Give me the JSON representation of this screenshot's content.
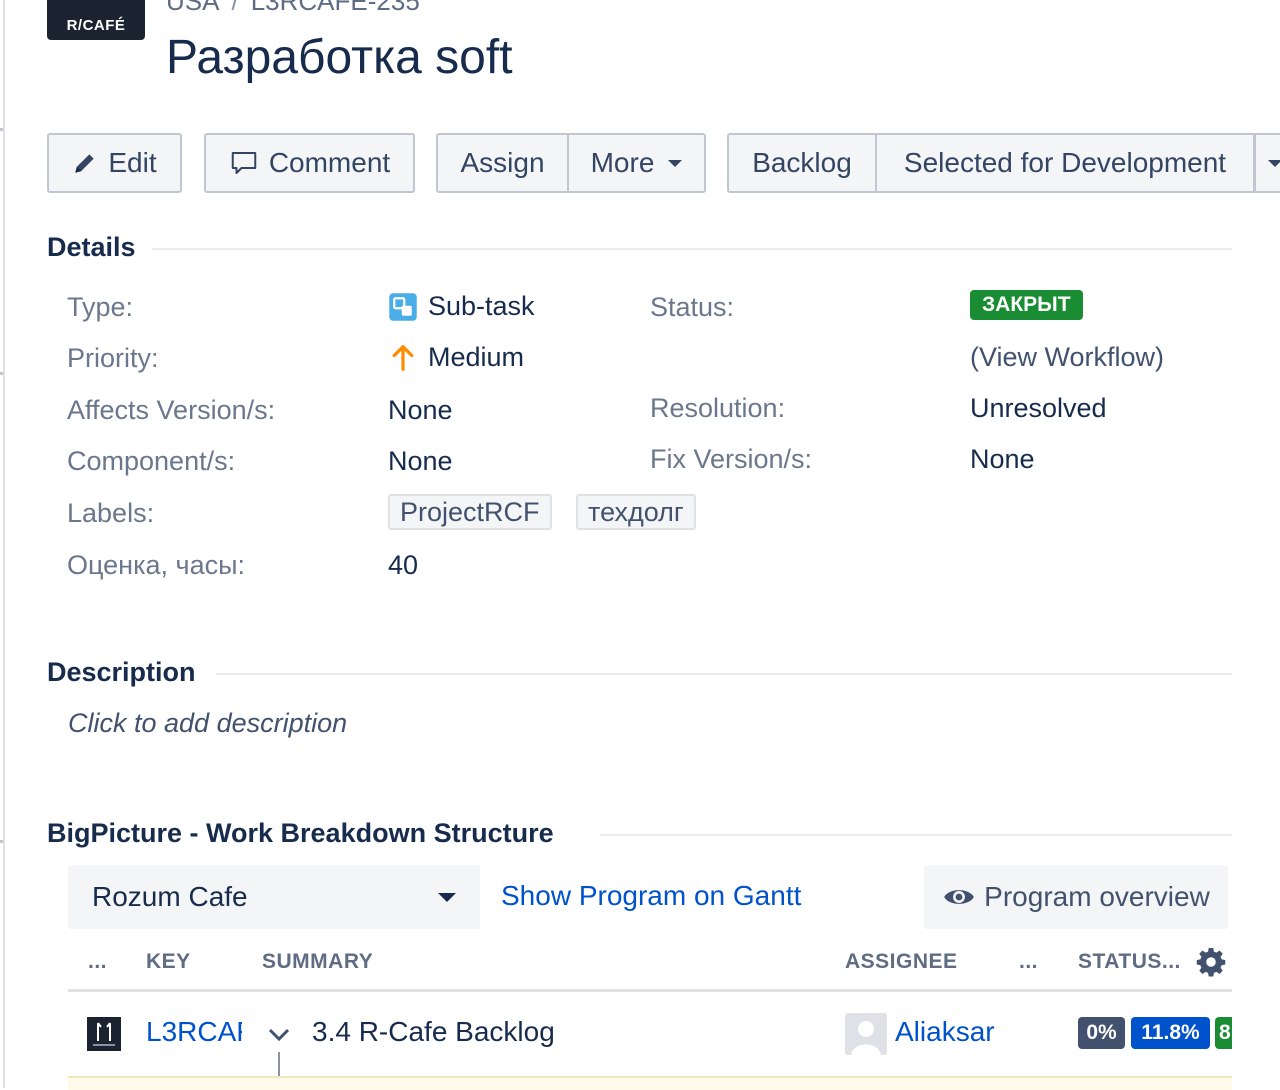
{
  "header": {
    "logo_text": "R/CAFÉ",
    "breadcrumbs": [
      "USA",
      "L3RCAFE-235"
    ],
    "title": "Разработка soft"
  },
  "toolbar": {
    "edit_label": "Edit",
    "comment_label": "Comment",
    "assign_label": "Assign",
    "more_label": "More",
    "workflow_buttons": [
      "Backlog",
      "Selected for Development"
    ]
  },
  "details": {
    "heading": "Details",
    "fields": {
      "type": {
        "label": "Type:",
        "value": "Sub-task"
      },
      "priority": {
        "label": "Priority:",
        "value": "Medium"
      },
      "affects_versions": {
        "label": "Affects Version/s:",
        "value": "None"
      },
      "components": {
        "label": "Component/s:",
        "value": "None"
      },
      "labels": {
        "label": "Labels:",
        "values": [
          "ProjectRCF",
          "техдолг"
        ]
      },
      "estimate": {
        "label": "Оценка, часы:",
        "value": "40"
      },
      "status": {
        "label": "Status:",
        "value": "ЗАКРЫТ",
        "workflow_link": "(View Workflow)"
      },
      "resolution": {
        "label": "Resolution:",
        "value": "Unresolved"
      },
      "fix_versions": {
        "label": "Fix Version/s:",
        "value": "None"
      }
    }
  },
  "description": {
    "heading": "Description",
    "placeholder": "Click to add description"
  },
  "bigpicture": {
    "heading": "BigPicture - Work Breakdown Structure",
    "program_select": "Rozum Cafe",
    "gantt_link": "Show Program on Gantt",
    "overview_button": "Program overview",
    "table": {
      "headers": [
        "...",
        "KEY",
        "SUMMARY",
        "ASSIGNEE",
        "...",
        "STATUS..."
      ],
      "rows": [
        {
          "key": "L3RCAF",
          "summary": "3.4 R-Cafe Backlog",
          "assignee": "Aliaksar",
          "progress": [
            "0%",
            "11.8%",
            "8"
          ]
        }
      ]
    }
  },
  "colors": {
    "status_done": "#1a8c33",
    "link": "#0052cc",
    "progress_todo": "#42526e",
    "progress_inprogress": "#0052cc",
    "progress_done": "#1a8c33",
    "priority_medium": "#ff8b00"
  }
}
